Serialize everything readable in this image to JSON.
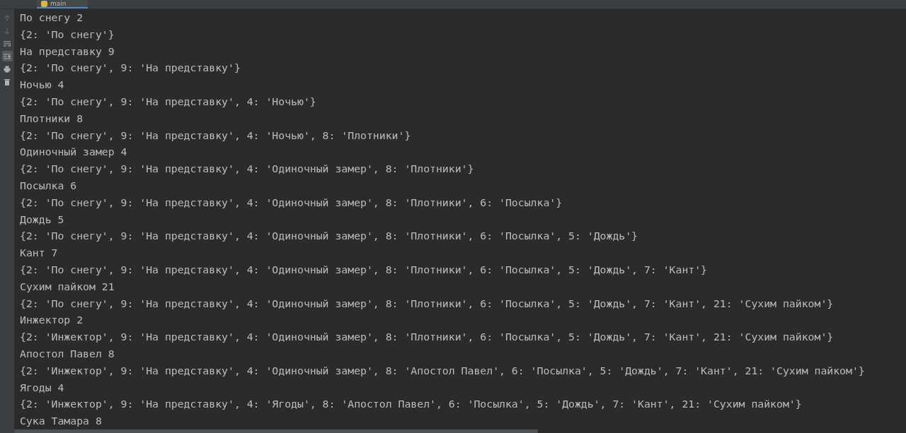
{
  "tab": {
    "label": "main",
    "selected": true
  },
  "toolbar": [
    {
      "kind": "up",
      "disabled": true,
      "selected": false
    },
    {
      "kind": "down",
      "disabled": true,
      "selected": false
    },
    {
      "kind": "wrap",
      "disabled": false,
      "selected": false
    },
    {
      "kind": "scroll-end",
      "disabled": false,
      "selected": true
    },
    {
      "kind": "print",
      "disabled": false,
      "selected": false
    },
    {
      "kind": "trash",
      "disabled": false,
      "selected": false
    }
  ],
  "output": [
    "По снегу 2",
    "{2: 'По снегу'}",
    "На представку 9",
    "{2: 'По снегу', 9: 'На представку'}",
    "Ночью 4",
    "{2: 'По снегу', 9: 'На представку', 4: 'Ночью'}",
    "Плотники 8",
    "{2: 'По снегу', 9: 'На представку', 4: 'Ночью', 8: 'Плотники'}",
    "Одиночный замер 4",
    "{2: 'По снегу', 9: 'На представку', 4: 'Одиночный замер', 8: 'Плотники'}",
    "Посылка 6",
    "{2: 'По снегу', 9: 'На представку', 4: 'Одиночный замер', 8: 'Плотники', 6: 'Посылка'}",
    "Дождь 5",
    "{2: 'По снегу', 9: 'На представку', 4: 'Одиночный замер', 8: 'Плотники', 6: 'Посылка', 5: 'Дождь'}",
    "Кант 7",
    "{2: 'По снегу', 9: 'На представку', 4: 'Одиночный замер', 8: 'Плотники', 6: 'Посылка', 5: 'Дождь', 7: 'Кант'}",
    "Сухим пайком 21",
    "{2: 'По снегу', 9: 'На представку', 4: 'Одиночный замер', 8: 'Плотники', 6: 'Посылка', 5: 'Дождь', 7: 'Кант', 21: 'Сухим пайком'}",
    "Инжектор 2",
    "{2: 'Инжектор', 9: 'На представку', 4: 'Одиночный замер', 8: 'Плотники', 6: 'Посылка', 5: 'Дождь', 7: 'Кант', 21: 'Сухим пайком'}",
    "Апостол Павел 8",
    "{2: 'Инжектор', 9: 'На представку', 4: 'Одиночный замер', 8: 'Апостол Павел', 6: 'Посылка', 5: 'Дождь', 7: 'Кант', 21: 'Сухим пайком'}",
    "Ягоды 4",
    "{2: 'Инжектор', 9: 'На представку', 4: 'Ягоды', 8: 'Апостол Павел', 6: 'Посылка', 5: 'Дождь', 7: 'Кант', 21: 'Сухим пайком'}",
    "Сука Тамара 8"
  ]
}
